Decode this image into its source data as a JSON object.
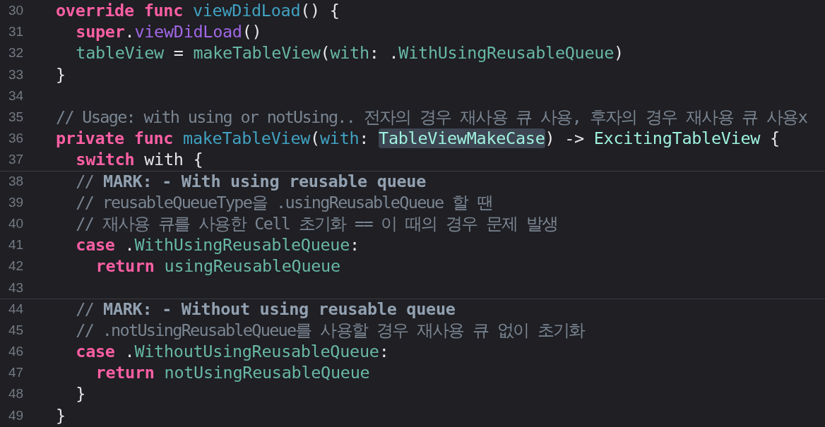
{
  "editor": {
    "lines": [
      {
        "number": "30",
        "kind": "code",
        "tokens": [
          {
            "kind": "keyword",
            "text": "override "
          },
          {
            "kind": "keyword",
            "text": "func "
          },
          {
            "kind": "decl",
            "text": "viewDidLoad"
          },
          {
            "kind": "plain",
            "text": "() {"
          }
        ],
        "children": [
          {
            "number": "31",
            "kind": "code",
            "tokens": [
              {
                "kind": "keyword",
                "text": "super"
              },
              {
                "kind": "plain",
                "text": "."
              },
              {
                "kind": "call",
                "text": "viewDidLoad"
              },
              {
                "kind": "plain",
                "text": "()"
              }
            ]
          },
          {
            "number": "32",
            "kind": "code",
            "tokens": [
              {
                "kind": "ident",
                "text": "tableView "
              },
              {
                "kind": "plain",
                "text": "= "
              },
              {
                "kind": "ident",
                "text": "makeTableView"
              },
              {
                "kind": "plain",
                "text": "("
              },
              {
                "kind": "ident",
                "text": "with"
              },
              {
                "kind": "plain",
                "text": ": ."
              },
              {
                "kind": "ident",
                "text": "WithUsingReusableQueue"
              },
              {
                "kind": "plain",
                "text": ")"
              }
            ]
          }
        ]
      },
      {
        "number": "33",
        "kind": "code",
        "tokens": [
          {
            "kind": "plain",
            "text": "}"
          }
        ]
      },
      {
        "number": "34",
        "kind": "code"
      },
      {
        "number": "35",
        "kind": "code",
        "tokens": [
          {
            "kind": "comment",
            "text": "// Usage: with using or notUsing.. 전자의 경우 재사용 큐 사용, 후자의 경우 재사용 큐 사용x"
          }
        ]
      },
      {
        "number": "36",
        "kind": "code",
        "tokens": [
          {
            "kind": "keyword",
            "text": "private "
          },
          {
            "kind": "keyword",
            "text": "func "
          },
          {
            "kind": "decl",
            "text": "makeTableView"
          },
          {
            "kind": "plain",
            "text": "("
          },
          {
            "kind": "decl",
            "text": "with"
          },
          {
            "kind": "plain",
            "text": ": "
          },
          {
            "kind": "type-highlighted",
            "text": "TableViewMakeCase"
          },
          {
            "kind": "plain",
            "text": ") -> "
          },
          {
            "kind": "type",
            "text": "ExcitingTableView"
          },
          {
            "kind": "plain",
            "text": " {"
          }
        ],
        "children": [
          {
            "number": "37",
            "kind": "code",
            "tokens": [
              {
                "kind": "keyword",
                "text": "switch "
              },
              {
                "kind": "plain",
                "text": "with {"
              }
            ]
          },
          {
            "number": "38",
            "kind": "mark",
            "tokens": [
              {
                "kind": "comment",
                "text": "// "
              },
              {
                "kind": "mark",
                "text": "MARK: - With using reusable queue"
              }
            ]
          },
          {
            "number": "39",
            "kind": "code",
            "tokens": [
              {
                "kind": "comment",
                "text": "// reusableQueueType을 .usingReusableQueue 할 땐"
              }
            ]
          },
          {
            "number": "40",
            "kind": "code",
            "tokens": [
              {
                "kind": "comment",
                "text": "// 재사용 큐를 사용한 Cell 초기화 == 이 때의 경우 문제 발생"
              }
            ]
          },
          {
            "number": "41",
            "kind": "code",
            "tokens": [
              {
                "kind": "keyword",
                "text": "case "
              },
              {
                "kind": "plain",
                "text": "."
              },
              {
                "kind": "ident",
                "text": "WithUsingReusableQueue"
              },
              {
                "kind": "plain",
                "text": ":"
              }
            ],
            "children": [
              {
                "number": "42",
                "kind": "code",
                "tokens": [
                  {
                    "kind": "keyword",
                    "text": "return "
                  },
                  {
                    "kind": "ident",
                    "text": "usingReusableQueue"
                  }
                ]
              }
            ]
          },
          {
            "number": "43",
            "kind": "code"
          },
          {
            "number": "44",
            "kind": "mark",
            "tokens": [
              {
                "kind": "comment",
                "text": "// "
              },
              {
                "kind": "mark",
                "text": "MARK: - Without using reusable queue"
              }
            ]
          },
          {
            "number": "45",
            "kind": "code",
            "tokens": [
              {
                "kind": "comment",
                "text": "// .notUsingReusableQueue를 사용할 경우 재사용 큐 없이 초기화"
              }
            ]
          },
          {
            "number": "46",
            "kind": "code",
            "tokens": [
              {
                "kind": "keyword",
                "text": "case "
              },
              {
                "kind": "plain",
                "text": "."
              },
              {
                "kind": "ident",
                "text": "WithoutUsingReusableQueue"
              },
              {
                "kind": "plain",
                "text": ":"
              }
            ],
            "children": [
              {
                "number": "47",
                "kind": "code",
                "tokens": [
                  {
                    "kind": "keyword",
                    "text": "return "
                  },
                  {
                    "kind": "ident",
                    "text": "notUsingReusableQueue"
                  }
                ]
              }
            ]
          },
          {
            "number": "48",
            "kind": "code",
            "tokens": [
              {
                "kind": "plain",
                "text": "}"
              }
            ]
          }
        ]
      },
      {
        "number": "49",
        "kind": "code",
        "tokens": [
          {
            "kind": "plain",
            "text": "}"
          }
        ]
      }
    ]
  }
}
